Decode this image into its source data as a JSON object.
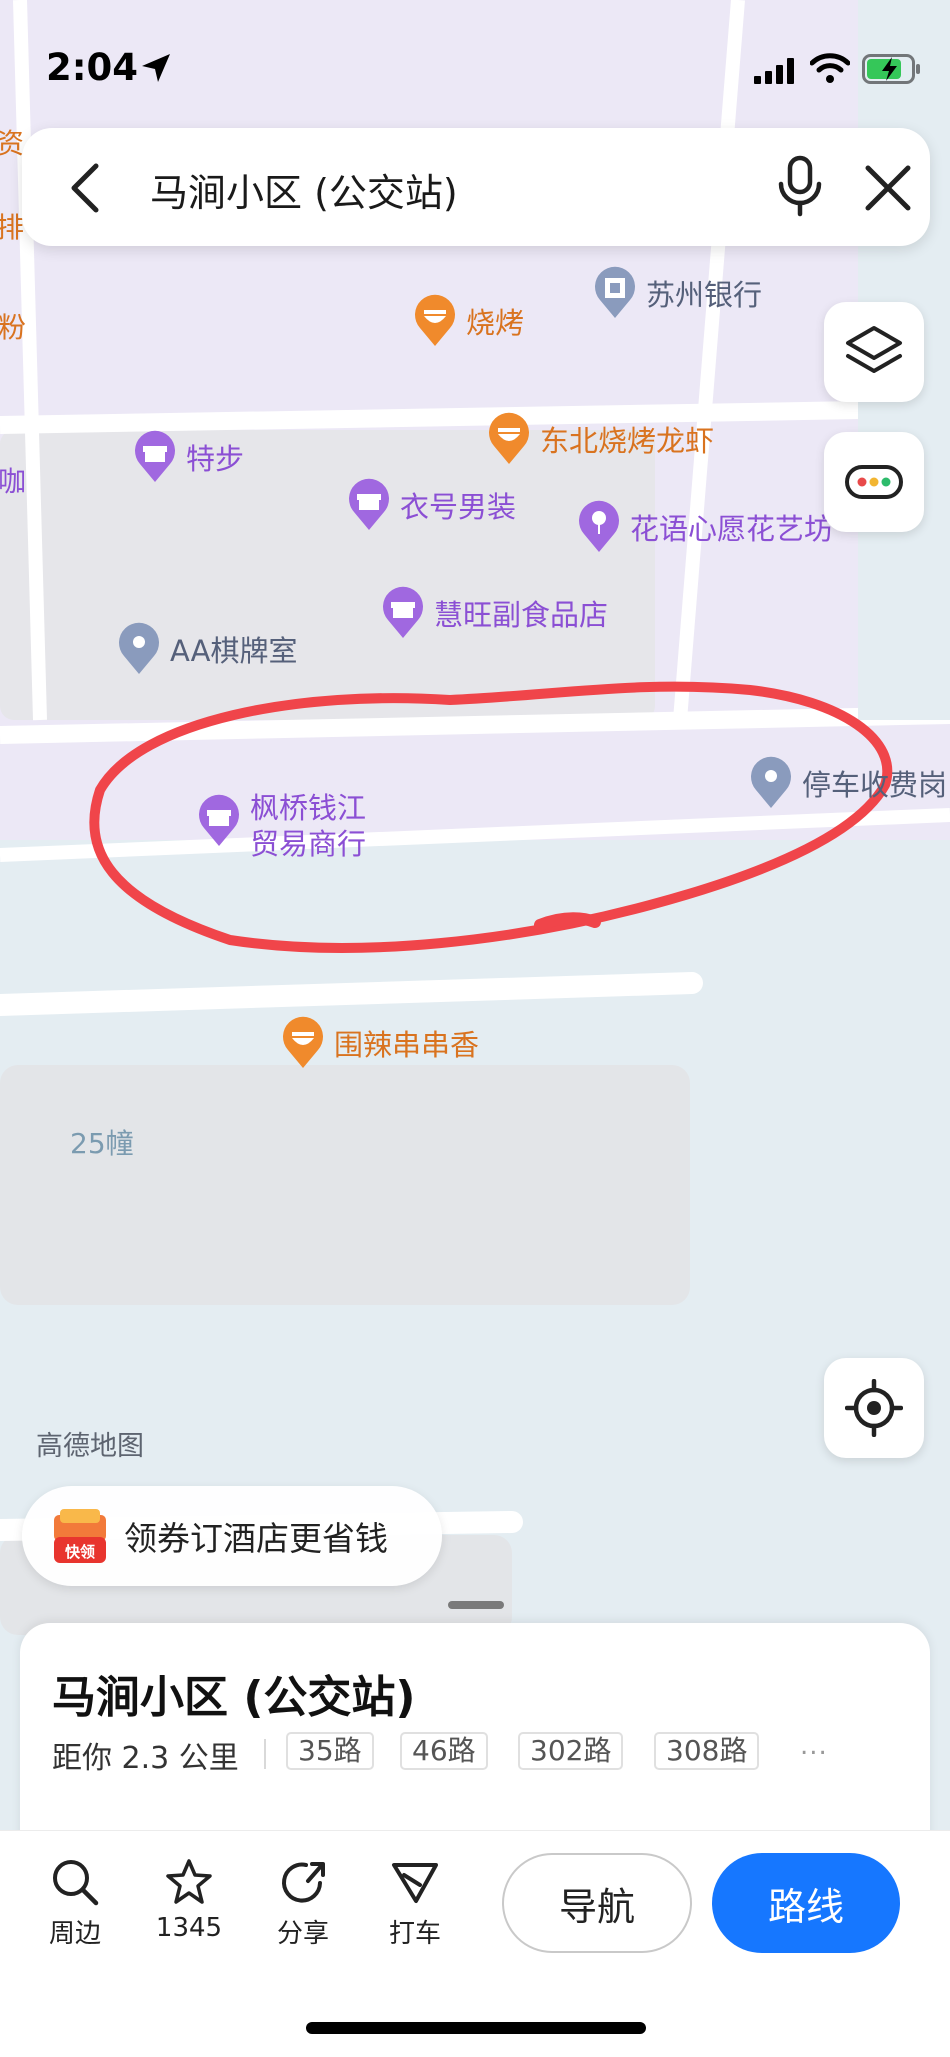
{
  "status_bar": {
    "time": "2:04"
  },
  "search": {
    "query": "马涧小区 (公交站)"
  },
  "map": {
    "pois": [
      {
        "name": "烧烤",
        "category": "food"
      },
      {
        "name": "苏州银行",
        "category": "bank"
      },
      {
        "name": "东北烧烤龙虾",
        "category": "food"
      },
      {
        "name": "特步",
        "category": "shop"
      },
      {
        "name": "衣号男装",
        "category": "shop"
      },
      {
        "name": "花语心愿花艺坊",
        "category": "florist"
      },
      {
        "name": "慧旺副食品店",
        "category": "shop"
      },
      {
        "name": "AA棋牌室",
        "category": "place"
      },
      {
        "name": "枫桥钱江\n贸易商行",
        "category": "shop"
      },
      {
        "name": "停车收费岗",
        "category": "place"
      },
      {
        "name": "围辣串串香",
        "category": "food"
      }
    ],
    "area_label": "25幢",
    "watermark": "高德地图",
    "edge_fragments": [
      "资",
      "排",
      "粉",
      "咖"
    ],
    "highlight_color": "#f0454a"
  },
  "coupon": {
    "badge_text": "快领",
    "text": "领券订酒店更省钱"
  },
  "place": {
    "title": "马涧小区 (公交站)",
    "distance": "距你 2.3 公里",
    "routes": [
      "35路",
      "46路",
      "302路",
      "308路"
    ],
    "more": "..."
  },
  "actions": {
    "nearby": "周边",
    "favorites_count": "1345",
    "share": "分享",
    "taxi": "打车",
    "navigate": "导航",
    "route": "路线"
  },
  "colors": {
    "accent": "#1677ff",
    "poi_purple": "#8b4fd4",
    "poi_orange": "#d9731f",
    "poi_gray": "#8a9bbd"
  }
}
